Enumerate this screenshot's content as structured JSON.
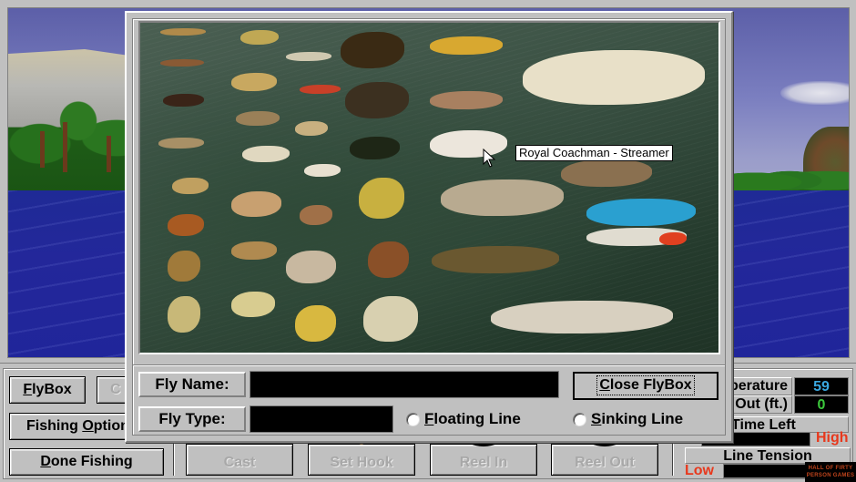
{
  "scene": {
    "description": "lake with forested shore, cliffs and cloudy sky",
    "colors": {
      "water": "#20259a",
      "sky": "#7b7fc0",
      "trees": "#2a7620"
    }
  },
  "flybox_dialog": {
    "tooltip": "Royal Coachman - Streamer",
    "cursor_icon": "arrow-cursor-icon",
    "fly_name_label": "Fly Name:",
    "fly_name_value": "",
    "fly_type_label": "Fly Type:",
    "fly_type_value": "",
    "close_button": {
      "prefix": "C",
      "rest": "lose FlyBox"
    },
    "line_options": [
      {
        "accel": "F",
        "rest": "loating Line",
        "selected": false
      },
      {
        "accel": "S",
        "rest": "inking Line",
        "selected": false
      }
    ]
  },
  "controls": {
    "flybox_button": {
      "accel": "F",
      "rest": "lyBox"
    },
    "hidden_button_partial": "C",
    "fishing_options_button": {
      "before": "Fishing ",
      "accel": "O",
      "rest": "ptions"
    },
    "done_fishing_button": {
      "accel": "D",
      "rest": "one Fishing"
    },
    "action_buttons": [
      {
        "label": "Cast",
        "enabled": false
      },
      {
        "label": "Set Hook",
        "enabled": false
      },
      {
        "label": "Reel In",
        "enabled": false
      },
      {
        "label": "Reel Out",
        "enabled": false
      }
    ]
  },
  "stats": {
    "temperature_label": "Temperature",
    "temperature_value": "59",
    "temperature_color": "#3aa8e0",
    "line_out_label": "Line Out (ft.)",
    "line_out_value": "0",
    "line_out_color": "#3cc83c",
    "time_left_label": "Time Left",
    "time_left_high": "High",
    "line_tension_label": "Line Tension",
    "line_tension_low": "Low",
    "line_tension_high": "High",
    "accent_red": "#e8381c"
  },
  "logo": {
    "line1": "HALL OF FIRTY",
    "line2": "PERSON GAMES"
  }
}
